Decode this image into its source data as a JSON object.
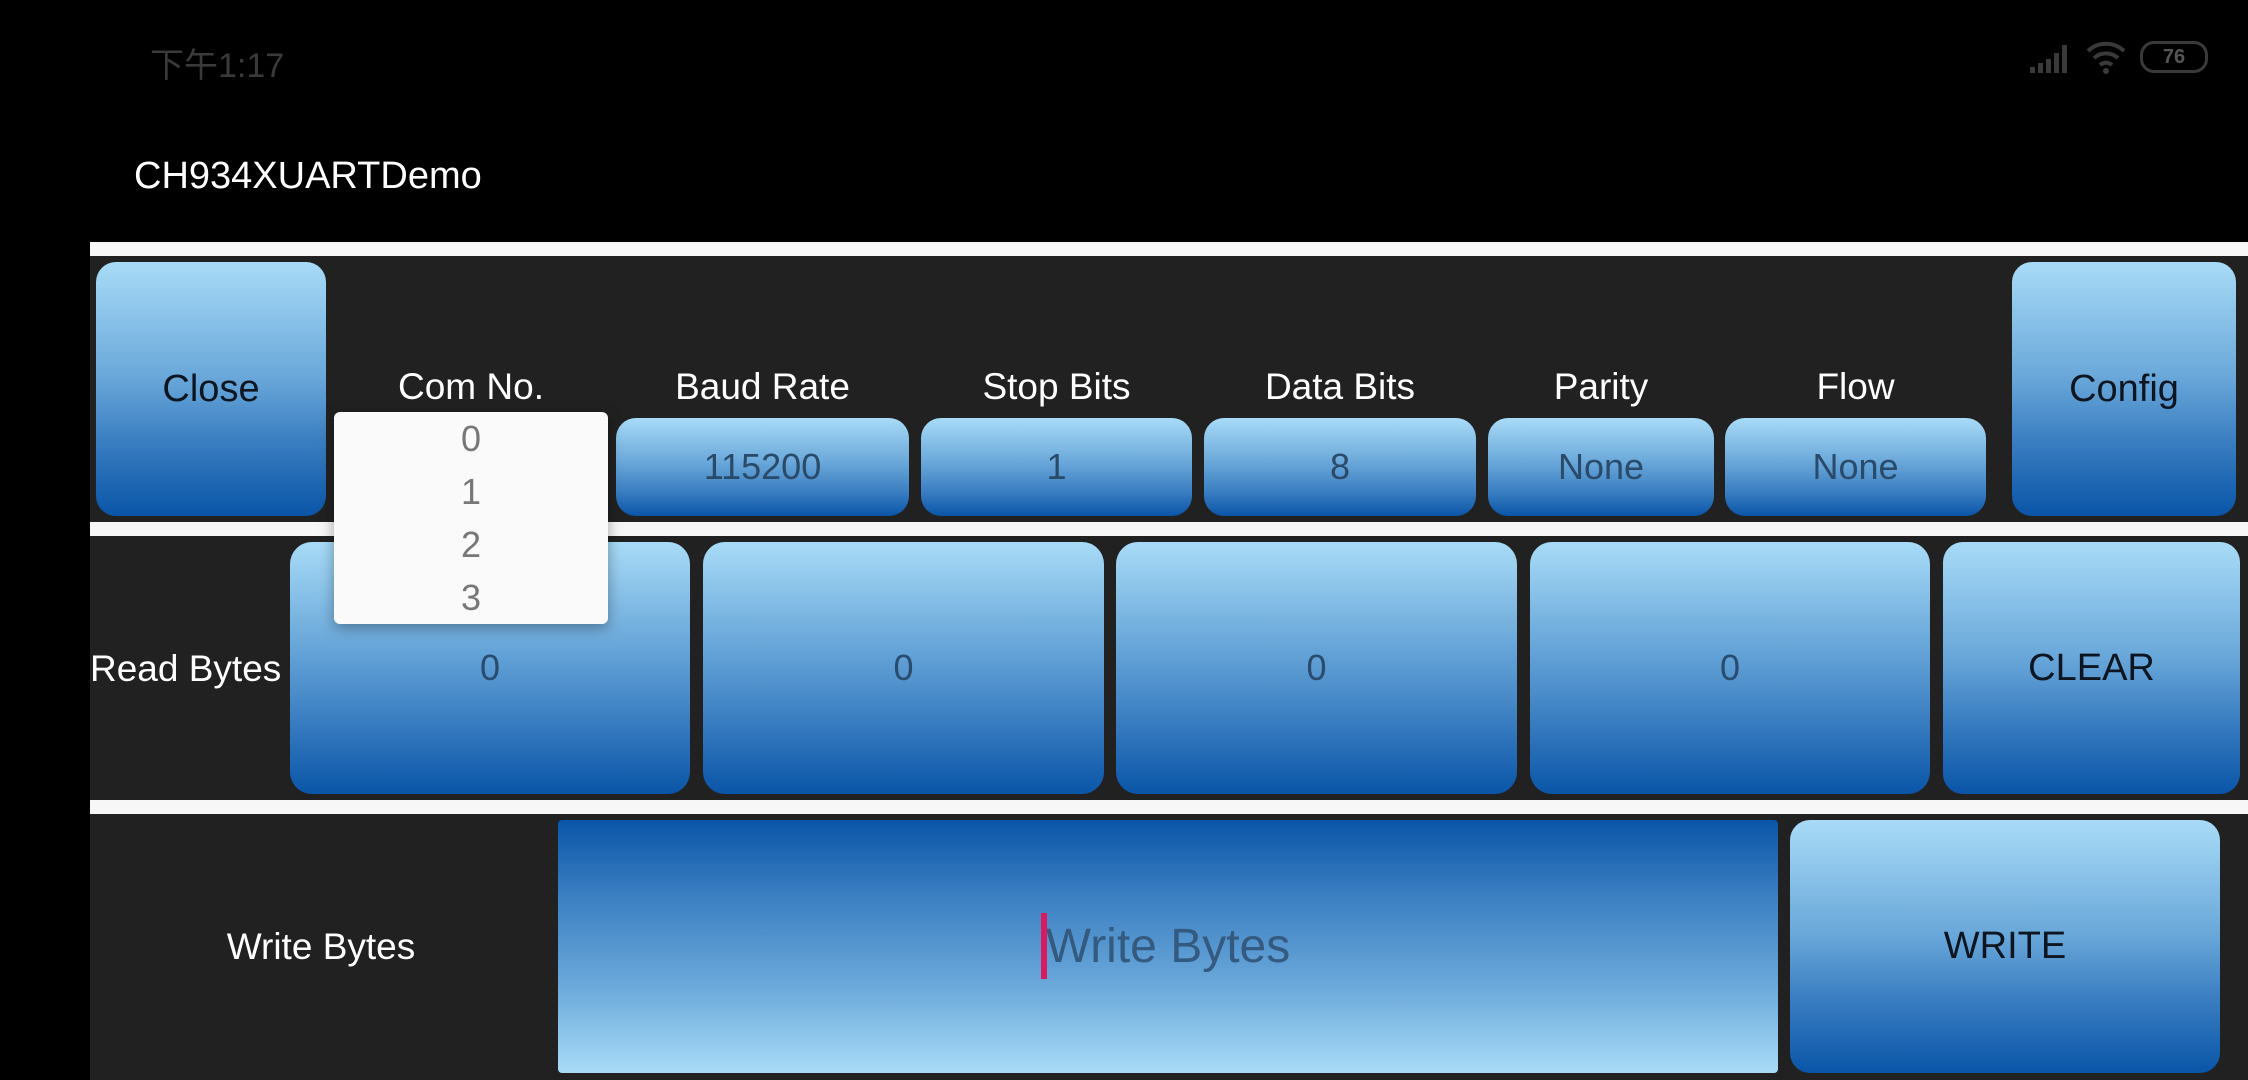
{
  "status_bar": {
    "time": "下午1:17",
    "battery": "76",
    "icons": [
      "signal-icon",
      "wifi-icon",
      "battery-icon"
    ]
  },
  "app": {
    "title": "CH934XUARTDemo"
  },
  "config_row": {
    "close_label": "Close",
    "config_label": "Config",
    "fields": [
      {
        "label": "Com No.",
        "value": "0"
      },
      {
        "label": "Baud Rate",
        "value": "115200"
      },
      {
        "label": "Stop Bits",
        "value": "1"
      },
      {
        "label": "Data Bits",
        "value": "8"
      },
      {
        "label": "Parity",
        "value": "None"
      },
      {
        "label": "Flow",
        "value": "None"
      }
    ],
    "com_dropdown_options": [
      "0",
      "1",
      "2",
      "3"
    ]
  },
  "read_row": {
    "label": "Read Bytes",
    "counters": [
      "0",
      "0",
      "0",
      "0"
    ],
    "clear_label": "CLEAR"
  },
  "write_row": {
    "label": "Write Bytes",
    "input_value": "",
    "input_placeholder": "Write Bytes",
    "write_label": "WRITE"
  },
  "colors": {
    "background": "#000000",
    "panel": "#212121",
    "separator": "#f7f7f7",
    "button_top": "#a8dbf7",
    "button_bottom": "#0a55a8",
    "cursor": "#d81b60"
  }
}
